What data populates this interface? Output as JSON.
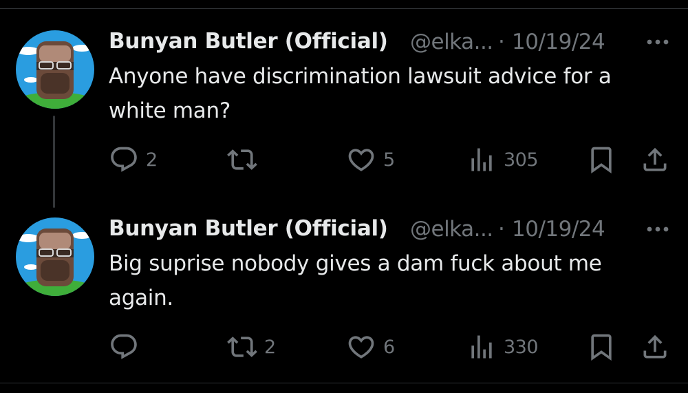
{
  "tweets": [
    {
      "author_name": "Bunyan Butler (Official)",
      "handle": "@elka...",
      "separator": "·",
      "date": "10/19/24",
      "text_lines": [
        "Anyone have discrimination lawsuit advice for a",
        "white man?"
      ],
      "actions": {
        "replies": "2",
        "reposts": "",
        "likes": "5",
        "views": "305"
      }
    },
    {
      "author_name": "Bunyan Butler (Official)",
      "handle": "@elka...",
      "separator": "·",
      "date": "10/19/24",
      "text_lines": [
        "Big suprise nobody gives a dam fuck about me",
        "again."
      ],
      "actions": {
        "replies": "",
        "reposts": "2",
        "likes": "6",
        "views": "330"
      }
    }
  ],
  "icons": [
    "avatar",
    "more-icon",
    "reply-icon",
    "repost-icon",
    "like-icon",
    "views-icon",
    "bookmark-icon",
    "share-icon"
  ],
  "colors": {
    "background": "#000000",
    "primary_text": "#e7e9ea",
    "secondary_text": "#71767b",
    "divider": "#2f3336",
    "thread_line": "#333639"
  }
}
